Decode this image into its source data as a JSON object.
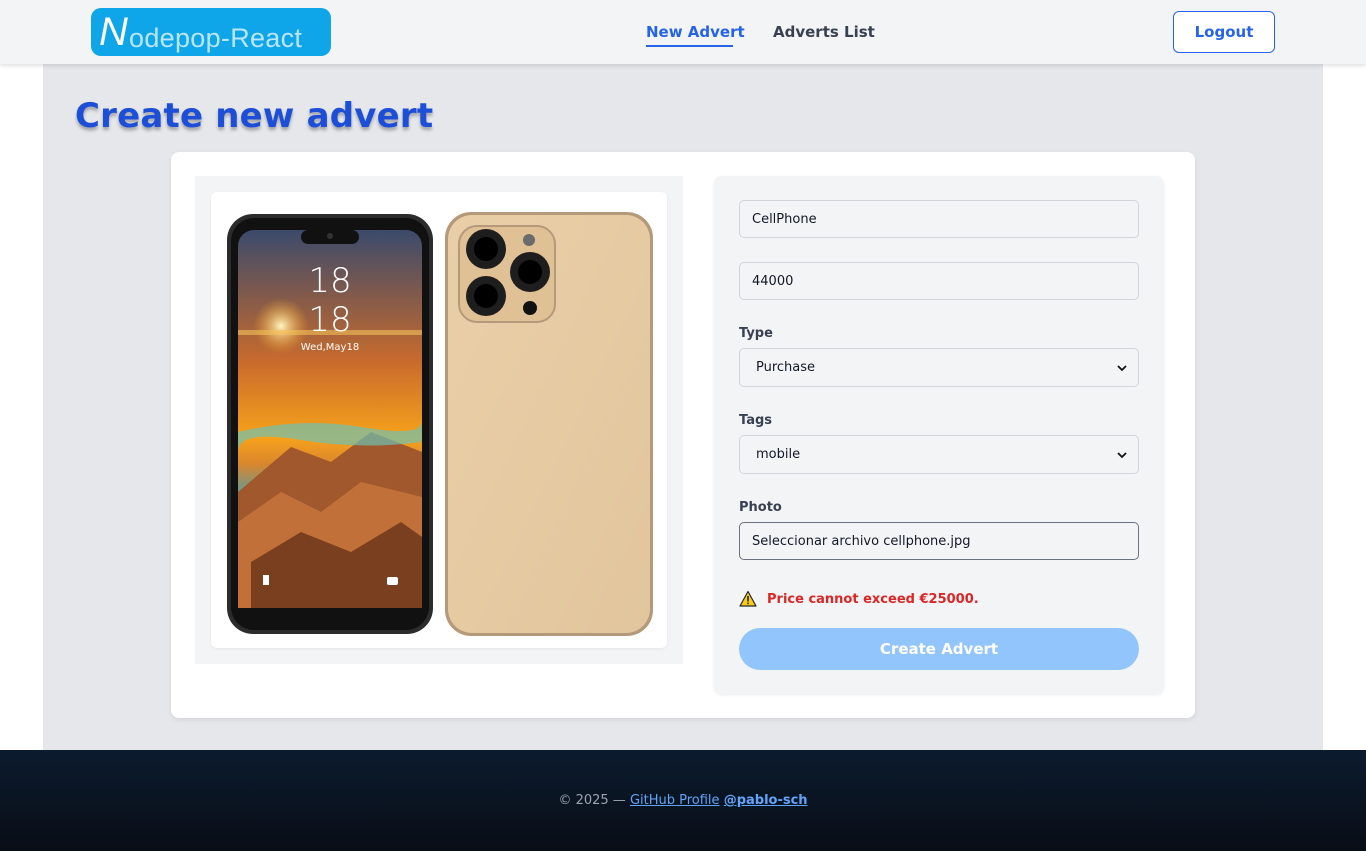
{
  "header": {
    "logo_initial": "N",
    "logo_rest": "odepop-React",
    "nav": {
      "new_advert": "New Advert",
      "adverts_list": "Adverts List"
    },
    "logout_label": "Logout"
  },
  "page": {
    "title": "Create new advert"
  },
  "form": {
    "name_value": "CellPhone",
    "price_value": "44000",
    "type_label": "Type",
    "type_selected": "Purchase",
    "tags_label": "Tags",
    "tags_selected": "mobile",
    "photo_label": "Photo",
    "photo_button": "Seleccionar archivo",
    "photo_filename": "cellphone.jpg",
    "error_message": "Price cannot exceed €25000.",
    "submit_label": "Create Advert"
  },
  "preview": {
    "clock_hour": "18",
    "clock_minute": "18",
    "clock_date": "Wed,May18"
  },
  "footer": {
    "copyright": "© 2025 —",
    "github_link": "GitHub Profile",
    "handle": "@pablo-sch"
  },
  "colors": {
    "accent": "#2563eb",
    "error": "#dc2626",
    "submit_disabled": "#93c5fd",
    "footer_bg": "#0b1b2e"
  },
  "icons": {
    "warning": "warning-icon",
    "select_arrow": "chevron-down-icon"
  }
}
